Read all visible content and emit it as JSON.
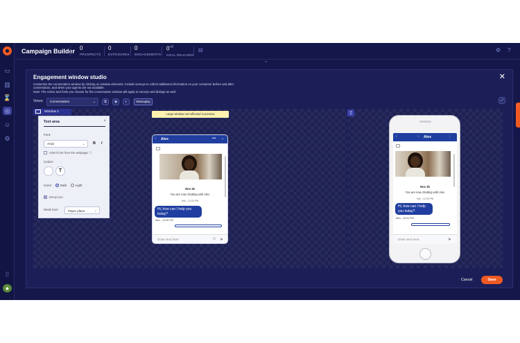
{
  "app": {
    "title": "Campaign Builder",
    "stats": [
      {
        "value": "0",
        "label": "PROSPECTS"
      },
      {
        "value": "0",
        "label": "EXPOSURES"
      },
      {
        "value": "0",
        "label": "ENGAGEMENTS"
      },
      {
        "value": "0",
        "sup": "+0",
        "label": "GOAL REACHED"
      }
    ]
  },
  "modal": {
    "title": "Engagement window studio",
    "description_1": "Customize the conversation window by clicking on window elements. Include surveys to collect additional information on your consumer before and after",
    "description_2": "conversation, and when your agents are not available.",
    "description_3": "Note: The colors and fonts you choose for the conversation window will apply to surveys and dialogs as well.",
    "views_label": "Views:",
    "views_value": "Conversation",
    "messaging_label": "Messaging",
    "window_tab": "Window 1",
    "warning": "Large window not reflected in preview",
    "cancel_label": "Cancel",
    "save_label": "Save"
  },
  "text_panel": {
    "title": "Text area",
    "font_label": "Font:",
    "font_value": "Arial",
    "bold": "B",
    "italic": "I",
    "inherit_label": "Inherit font from the webpage",
    "colors_label": "Colors:",
    "swatch_text": "T",
    "icons_label": "Icons:",
    "icons_dark": "Dark",
    "icons_light": "Light",
    "emoji_label": "Emoji icon",
    "send_label": "Send icon:",
    "send_value": "Paper plane"
  },
  "chat": {
    "agent_name": "Alex",
    "date": "Nov 25",
    "system_message": "You are now chatting with Alex",
    "system_meta": "Info - 12:00 PM",
    "bubble_text": "Hi, how can I help you today?",
    "bubble_meta_desktop": "Alex - 12:00 PM",
    "bubble_meta_mobile": "Alex - 12:01 PM",
    "input_placeholder": "Enter text here"
  },
  "colors": {
    "accent": "#f05a22",
    "chat_header": "#1f3e9f",
    "background": "#15174a"
  },
  "icons": [
    "gear-icon",
    "help-icon",
    "chat-icon",
    "chart-icon",
    "trophy-icon",
    "campaign-icon",
    "smile-icon",
    "settings-icon",
    "apps-icon",
    "close-icon",
    "chevron-down-icon",
    "send-icon",
    "emoji-icon",
    "mobile-icon",
    "back-icon",
    "more-icon"
  ]
}
